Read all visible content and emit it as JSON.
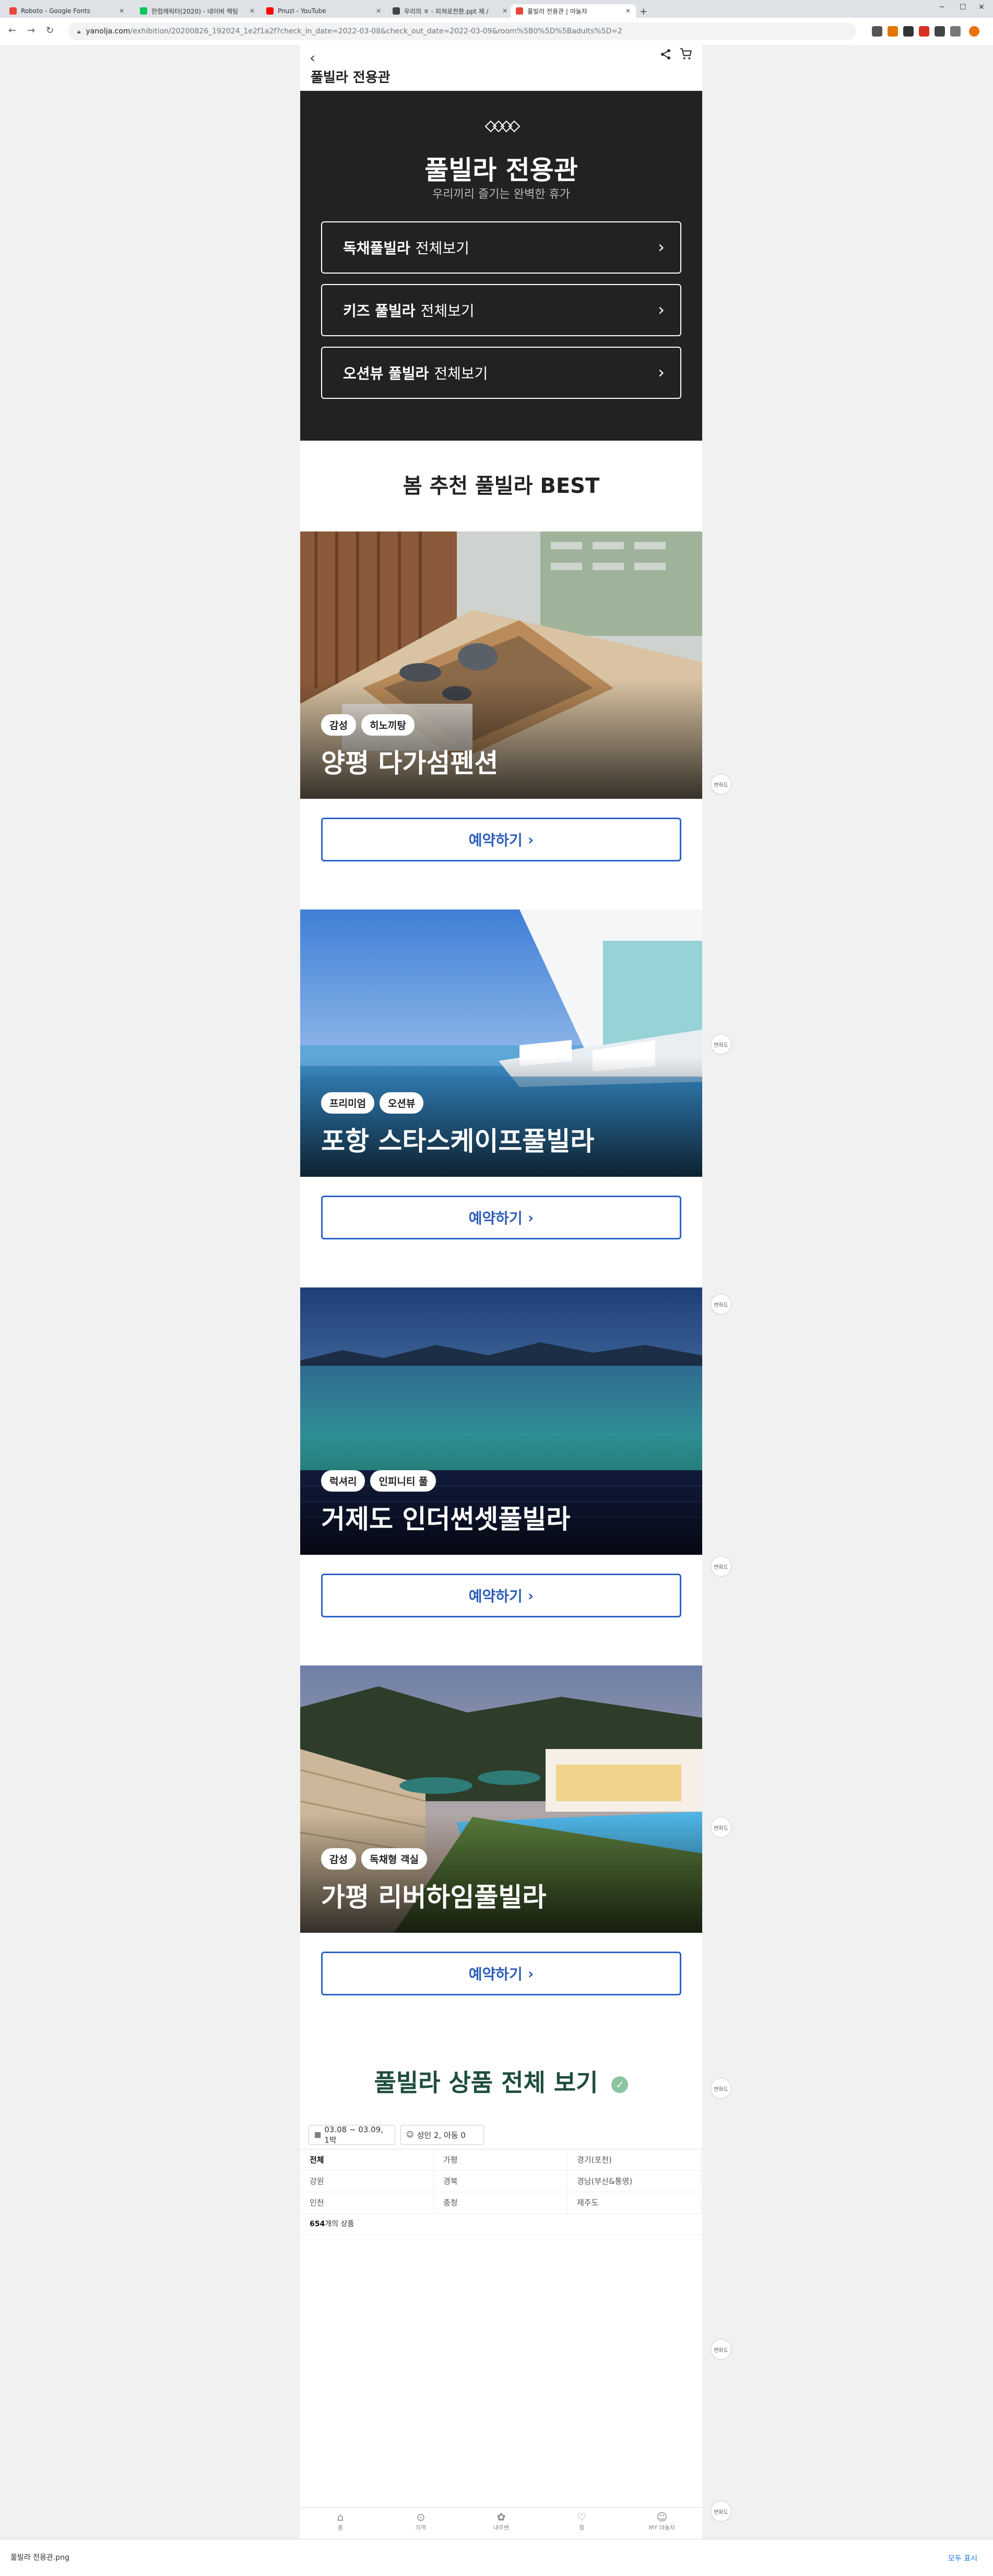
{
  "browser": {
    "tabs": [
      {
        "label": "Roboto - Google Fonts",
        "color": "#e8453c",
        "active": false
      },
      {
        "label": "한컴캐릭터(2020) - 네이버 책팀",
        "color": "#03c75a",
        "active": false
      },
      {
        "label": "Pnuzi - YouTube",
        "color": "#ff0000",
        "active": false
      },
      {
        "label": "우리의 ㅎ - 피쳐로전환.ppt 제 /",
        "color": "#444444",
        "active": false
      },
      {
        "label": "풀빌라 전용관 | 야놀자",
        "color": "#e8453c",
        "active": true
      }
    ],
    "new_tab": "+",
    "url_domain": "yanolja.com",
    "url_path": "/exhibition/20200826_192024_1e2f1a2f?check_in_date=2022-03-08&check_out_date=2022-03-09&room%5B0%5D%5Badults%5D=2"
  },
  "header": {
    "back_icon": "‹",
    "title": "풀빌라 전용관",
    "share_icon": "⟨",
    "cart_icon": "cart"
  },
  "hero": {
    "title": "풀빌라 전용관",
    "subtitle": "우리끼리 즐기는 완벽한 휴가",
    "buttons": [
      {
        "bold": "독채풀빌라",
        "rest": "전체보기"
      },
      {
        "bold": "키즈 풀빌라",
        "rest": "전체보기"
      },
      {
        "bold": "오션뷰 풀빌라",
        "rest": "전체보기"
      }
    ]
  },
  "best": {
    "title": "봄 추천 풀빌라 BEST",
    "reserve_label": "예약하기",
    "cards": [
      {
        "name": "양평 다가섬펜션",
        "tags": [
          "감성",
          "히노끼탕"
        ]
      },
      {
        "name": "포항 스타스케이프풀빌라",
        "tags": [
          "프리미엄",
          "오션뷰"
        ]
      },
      {
        "name": "거제도 인더썬셋풀빌라",
        "tags": [
          "럭셔리",
          "인피니티 풀"
        ]
      },
      {
        "name": "가평 리버하임풀빌라",
        "tags": [
          "감성",
          "독채형 객실"
        ]
      }
    ]
  },
  "all_products": {
    "title": "풀빌라 상품 전체 보기",
    "check_icon": "✓",
    "date_filter": "03.08 ~ 03.09, 1박",
    "guest_filter": "성인 2, 아동 0",
    "regions": [
      [
        "전체",
        "가평",
        "경기(포천)"
      ],
      [
        "강원",
        "경북",
        "경남(부산&통영)"
      ],
      [
        "인천",
        "충청",
        "제주도"
      ]
    ],
    "count_num": "654",
    "count_text": "개의 상품"
  },
  "bottom_nav": [
    {
      "icon": "⌂",
      "label": "홈"
    },
    {
      "icon": "⊙",
      "label": "지역"
    },
    {
      "icon": "✿",
      "label": "내주변"
    },
    {
      "icon": "♡",
      "label": "찜"
    },
    {
      "icon": "☺",
      "label": "MY 야놀자"
    }
  ],
  "side_fab_label": "변화도",
  "download_bar": {
    "item": "풀빌라 전용관.png",
    "show_all": "모두 표시"
  }
}
